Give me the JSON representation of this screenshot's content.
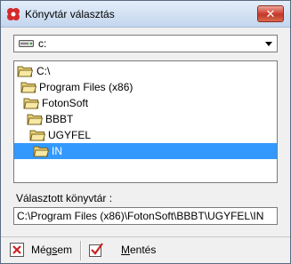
{
  "window": {
    "title": "Könyvtár választás",
    "close_glyph": "✕"
  },
  "drive": {
    "selected": "c:",
    "icon": "drive-icon"
  },
  "tree": {
    "items": [
      {
        "label": "C:\\",
        "icon": "folder-open-icon",
        "selected": false
      },
      {
        "label": "Program Files (x86)",
        "icon": "folder-open-icon",
        "selected": false
      },
      {
        "label": "FotonSoft",
        "icon": "folder-open-icon",
        "selected": false
      },
      {
        "label": "BBBT",
        "icon": "folder-open-icon",
        "selected": false
      },
      {
        "label": "UGYFEL",
        "icon": "folder-open-icon",
        "selected": false
      },
      {
        "label": "IN",
        "icon": "folder-open-icon",
        "selected": true
      }
    ]
  },
  "selected_caption": "Választott könyvtár :",
  "selected_path": "C:\\Program Files (x86)\\FotonSoft\\BBBT\\UGYFEL\\IN",
  "footer": {
    "cancel_prefix": "Még",
    "cancel_underlined": "s",
    "cancel_suffix": "em",
    "save_prefix": "",
    "save_underlined": "M",
    "save_suffix": "entés"
  },
  "colors": {
    "selection": "#3399ff",
    "cancel_icon": "#cc2222",
    "save_icon": "#cc2222"
  }
}
